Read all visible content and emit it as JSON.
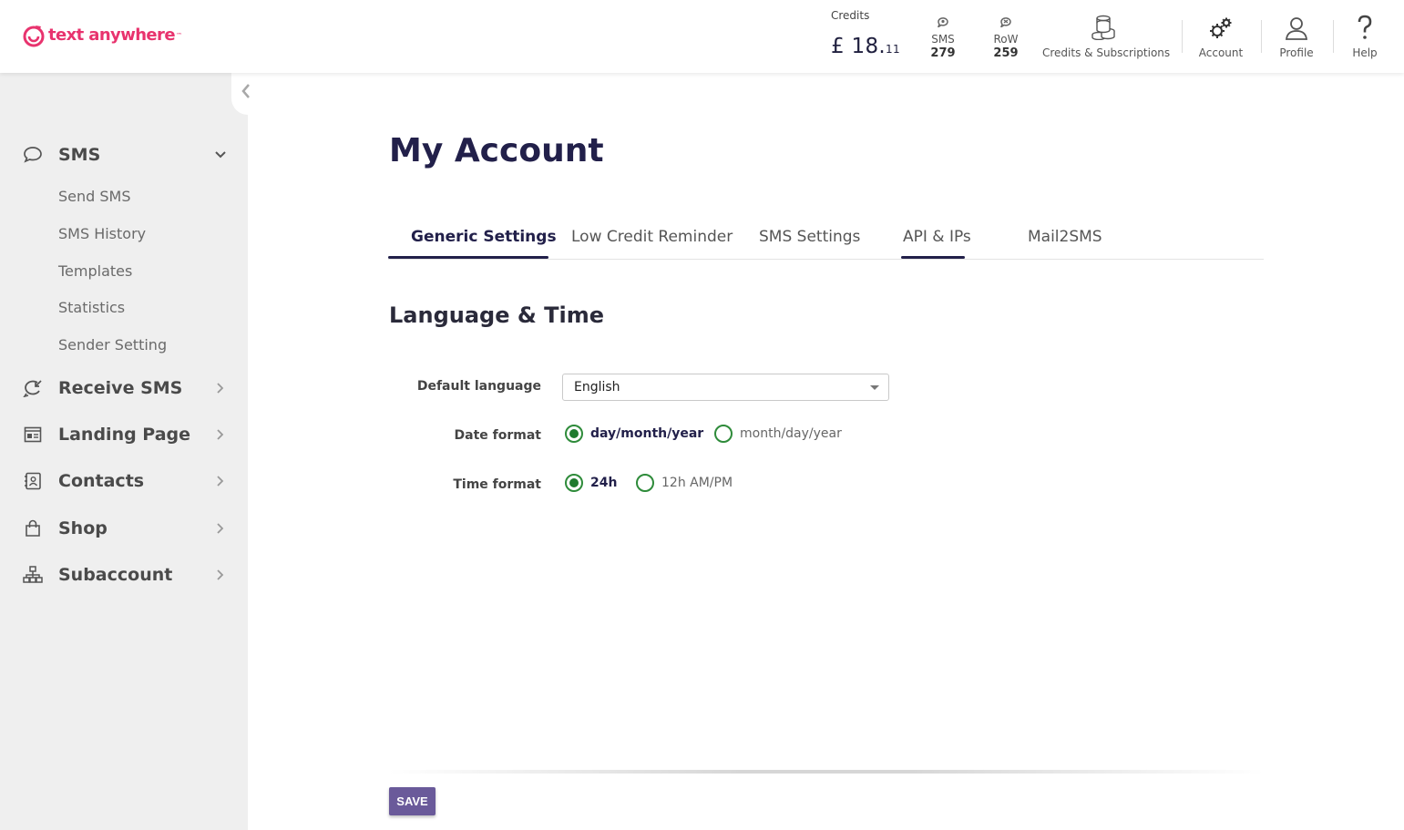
{
  "brand": {
    "name": "text anywhere",
    "tm": "™",
    "color": "#e8336e"
  },
  "header": {
    "credits_label": "Credits",
    "credits_whole": "£ 18.",
    "credits_cents": "11",
    "counts": [
      {
        "label": "SMS",
        "value": "279",
        "icon": "sms-credit-icon"
      },
      {
        "label": "RoW",
        "value": "259",
        "icon": "row-credit-icon"
      }
    ],
    "nav": [
      {
        "label": "Credits & Subscriptions",
        "icon": "coins-icon"
      },
      {
        "label": "Account",
        "icon": "gears-icon"
      },
      {
        "label": "Profile",
        "icon": "user-icon"
      },
      {
        "label": "Help",
        "icon": "question-icon"
      }
    ]
  },
  "sidebar": {
    "sections": [
      {
        "label": "SMS",
        "icon": "chat-bubble-icon",
        "expanded": true,
        "items": [
          "Send SMS",
          "SMS History",
          "Templates",
          "Statistics",
          "Sender Setting"
        ]
      },
      {
        "label": "Receive SMS",
        "icon": "receive-icon"
      },
      {
        "label": "Landing Page",
        "icon": "landing-page-icon"
      },
      {
        "label": "Contacts",
        "icon": "contacts-icon"
      },
      {
        "label": "Shop",
        "icon": "shopping-bag-icon"
      },
      {
        "label": "Subaccount",
        "icon": "org-chart-icon"
      }
    ]
  },
  "main": {
    "title": "My Account",
    "tabs": [
      "Generic Settings",
      "Low Credit Reminder",
      "SMS Settings",
      "API & IPs",
      "Mail2SMS"
    ],
    "active_tab": "Generic Settings",
    "section_title": "Language & Time",
    "form": {
      "language_label": "Default language",
      "language_value": "English",
      "date_label": "Date format",
      "date_options": [
        "day/month/year",
        "month/day/year"
      ],
      "date_selected": "day/month/year",
      "time_label": "Time format",
      "time_options": [
        "24h",
        "12h AM/PM"
      ],
      "time_selected": "24h"
    },
    "save_label": "SAVE"
  },
  "colors": {
    "accent": "#22204a",
    "radio": "#1f7a2e",
    "save_button": "#6a5a9a",
    "sidebar_bg": "#efefef"
  }
}
